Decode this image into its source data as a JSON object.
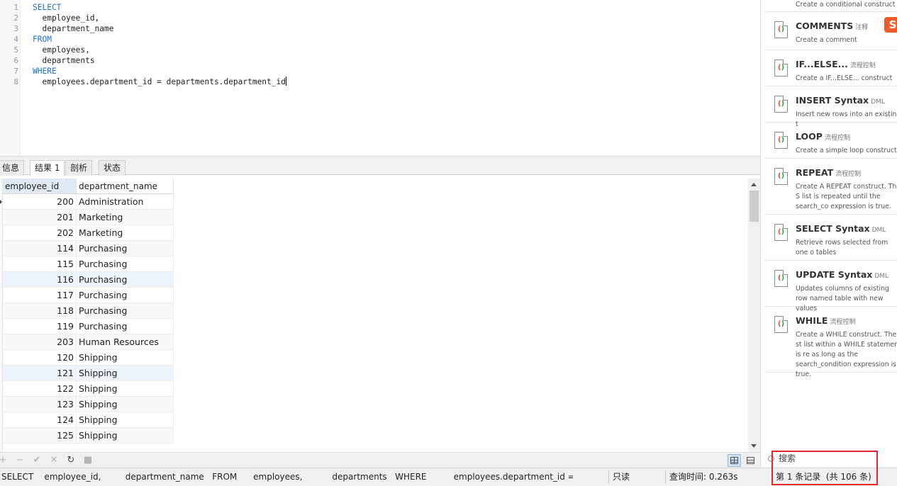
{
  "editor": {
    "line_numbers": [
      "1",
      "2",
      "3",
      "4",
      "5",
      "6",
      "7",
      "8"
    ],
    "lines": [
      {
        "kw": "SELECT",
        "text": ""
      },
      {
        "kw": "",
        "text": "  employee_id,"
      },
      {
        "kw": "",
        "text": "  department_name"
      },
      {
        "kw": "FROM",
        "text": ""
      },
      {
        "kw": "",
        "text": "  employees,"
      },
      {
        "kw": "",
        "text": "  departments"
      },
      {
        "kw": "WHERE",
        "text": ""
      },
      {
        "kw": "",
        "text": "  employees.department_id = departments.department_id"
      }
    ]
  },
  "result_tabs": [
    {
      "label": "信息",
      "active": false
    },
    {
      "label": "结果 1",
      "active": true
    },
    {
      "label": "剖析",
      "active": false
    },
    {
      "label": "状态",
      "active": false
    }
  ],
  "grid": {
    "columns": [
      "employee_id",
      "department_name"
    ],
    "rows": [
      [
        "200",
        "Administration"
      ],
      [
        "201",
        "Marketing"
      ],
      [
        "202",
        "Marketing"
      ],
      [
        "114",
        "Purchasing"
      ],
      [
        "115",
        "Purchasing"
      ],
      [
        "116",
        "Purchasing"
      ],
      [
        "117",
        "Purchasing"
      ],
      [
        "118",
        "Purchasing"
      ],
      [
        "119",
        "Purchasing"
      ],
      [
        "203",
        "Human Resources"
      ],
      [
        "120",
        "Shipping"
      ],
      [
        "121",
        "Shipping"
      ],
      [
        "122",
        "Shipping"
      ],
      [
        "123",
        "Shipping"
      ],
      [
        "124",
        "Shipping"
      ],
      [
        "125",
        "Shipping"
      ]
    ]
  },
  "grid_toolbar": {
    "add": "+",
    "remove": "−",
    "apply": "✔",
    "discard": "✕",
    "refresh": "↻",
    "stop": "■"
  },
  "statusbar": {
    "query": "SELECT    employee_id,         department_name   FROM      employees,           departments   WHERE          employees.department_id = depa",
    "mode": "只读",
    "query_time": "查询时间: 0.263s",
    "records": "第 1 条记录  (共 106 条)"
  },
  "snippets_panel": {
    "top_partial_desc": "Create a conditional construct",
    "ime_badge": "S",
    "items": [
      {
        "title": "COMMENTS",
        "tag": "注释",
        "desc": "Create a comment"
      },
      {
        "title": "IF...ELSE...",
        "tag": "流程控制",
        "desc": "Create a IF...ELSE... construct"
      },
      {
        "title": "INSERT Syntax",
        "tag": "DML",
        "desc": "Insert new rows into an existing t"
      },
      {
        "title": "LOOP",
        "tag": "流程控制",
        "desc": "Create a simple loop construct"
      },
      {
        "title": "REPEAT",
        "tag": "流程控制",
        "desc": "Create A REPEAT construct. The S list is repeated until the search_co expression is true."
      },
      {
        "title": "SELECT Syntax",
        "tag": "DML",
        "desc": "Retrieve rows selected from one o tables"
      },
      {
        "title": "UPDATE Syntax",
        "tag": "DML",
        "desc": "Updates columns of existing row named table with new values"
      },
      {
        "title": "WHILE",
        "tag": "流程控制",
        "desc": "Create a WHILE construct. The st list within a WHILE statement is re as long as the search_condition expression is true."
      }
    ],
    "search_label": "搜索"
  },
  "colors": {
    "keyword": "#1a72d2",
    "highlight_box": "#e0282e",
    "selected_header": "#dfeaf6"
  }
}
